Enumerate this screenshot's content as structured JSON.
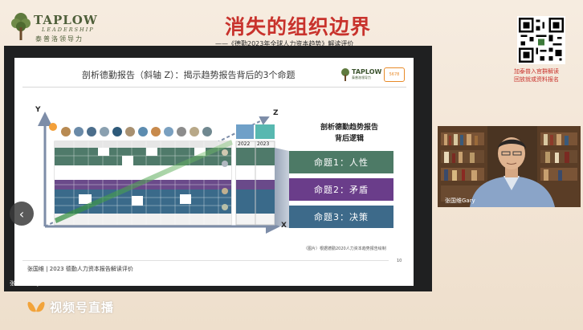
{
  "header": {
    "logo_title": "TAPLOW",
    "logo_sub": "LEADERSHIP",
    "logo_cn": "泰普洛领导力",
    "main_title": "消失的组织边界",
    "sub_title": "——《德勤2023年全球人力资本趋势》解读评价",
    "qr_caption_1": "加泰普入官群解读",
    "qr_caption_2": "回放就或资料报名"
  },
  "slide": {
    "title": "剖析德勤报告（斜轴 Z）：揭示趋势报告背后的3个命题",
    "logo_text": "TAPLOW",
    "logo_sub": "泰普洛领导力",
    "badge": "5678",
    "axis_y": "Y",
    "axis_x": "X",
    "axis_z": "Z",
    "year_a": "2022",
    "year_b": "2023",
    "right_heading_1": "剖析德勤趋势报告",
    "right_heading_2": "背后逻辑",
    "propositions": [
      "命题1：人性",
      "命题2：矛盾",
      "命题3：决策"
    ],
    "source_note": "（图片）根据德勤2020人力资本趋势报告绘制",
    "page_no": "10",
    "footer": "张国维 | 2023 德勤人力资本报告解读评价",
    "speaker_label": "张国维Gary"
  },
  "video": {
    "name_label": "张国维Gary"
  },
  "live": {
    "label": "视频号直播"
  },
  "colors": {
    "accent_red": "#c8322c",
    "brand_green": "#4f5f3a",
    "prop1": "#4d7a66",
    "prop2": "#6a3d8a",
    "prop3": "#3d6a8a"
  }
}
